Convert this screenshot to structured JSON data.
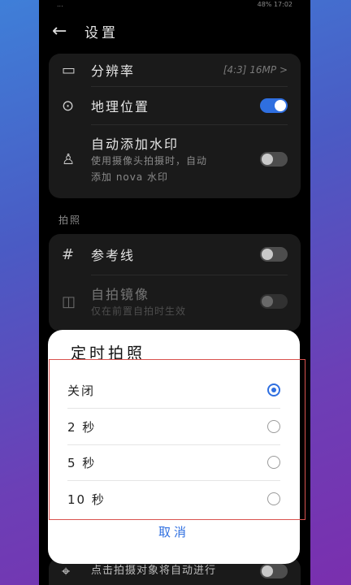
{
  "status": {
    "left": "...",
    "battery": "48%",
    "time": "17:02"
  },
  "header": {
    "back_icon": "back-arrow-icon",
    "title": "设置"
  },
  "card1": {
    "resolution": {
      "label": "分辨率",
      "value": "[4:3] 16MP >"
    },
    "location": {
      "label": "地理位置",
      "on": true
    },
    "watermark": {
      "label": "自动添加水印",
      "sub1": "使用摄像头拍摄时，自动",
      "sub2": "添加 nova 水印",
      "on": false
    }
  },
  "section": {
    "label": "拍照"
  },
  "card2": {
    "grid": {
      "label": "参考线",
      "on": false
    },
    "mirror": {
      "label": "自拍镜像",
      "sub": "仅在前置自拍时生效"
    }
  },
  "bottom": {
    "text": "点击拍摄对象将自动进行"
  },
  "dialog": {
    "title": "定时拍照",
    "options": [
      {
        "label": "关闭",
        "selected": true
      },
      {
        "label": "2 秒",
        "selected": false
      },
      {
        "label": "5 秒",
        "selected": false
      },
      {
        "label": "10 秒",
        "selected": false
      }
    ],
    "cancel": "取消"
  },
  "colors": {
    "accent": "#2f6fe0",
    "highlight": "#d9534f"
  }
}
